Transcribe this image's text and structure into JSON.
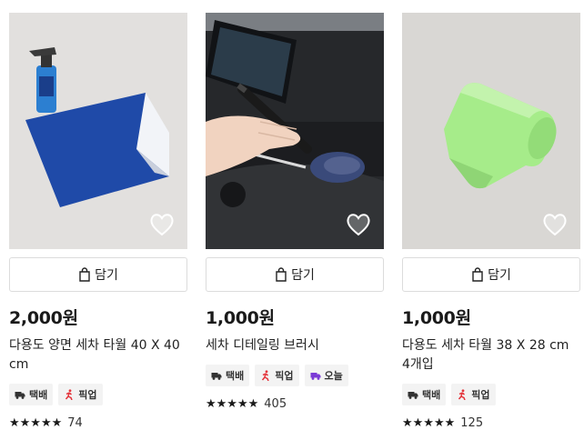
{
  "colors": {
    "towel_blue": "#1f4aa8",
    "towel_green": "#a6ec8a",
    "pickup_red": "#e4333a",
    "today_purple": "#7b3bd6",
    "star": "#1a1a1a"
  },
  "products": [
    {
      "image_icon": "blue-microfiber-towel-with-spray-bottle",
      "wishlist_icon": "heart-outline-icon",
      "cart_label": "담기",
      "price": "2,000원",
      "title": "다용도 양면 세차 타월 40 X 40 cm",
      "badges": [
        {
          "icon": "truck-icon",
          "label": "택배",
          "color": "#333333"
        },
        {
          "icon": "pickup-runner-icon",
          "label": "픽업",
          "color": "#e4333a"
        }
      ],
      "rating": 5,
      "stars": "★★★★★",
      "review_count": "74"
    },
    {
      "image_icon": "detailing-brush-in-car-interior",
      "wishlist_icon": "heart-outline-icon",
      "cart_label": "담기",
      "price": "1,000원",
      "title": "세차 디테일링 브러시",
      "badges": [
        {
          "icon": "truck-icon",
          "label": "택배",
          "color": "#333333"
        },
        {
          "icon": "pickup-runner-icon",
          "label": "픽업",
          "color": "#e4333a"
        },
        {
          "icon": "today-delivery-icon",
          "label": "오늘",
          "color": "#7b3bd6"
        }
      ],
      "rating": 5,
      "stars": "★★★★★",
      "review_count": "405"
    },
    {
      "image_icon": "rolled-green-towels",
      "wishlist_icon": "heart-outline-icon",
      "cart_label": "담기",
      "price": "1,000원",
      "title": "다용도 세차 타월 38 X 28 cm 4개입",
      "badges": [
        {
          "icon": "truck-icon",
          "label": "택배",
          "color": "#333333"
        },
        {
          "icon": "pickup-runner-icon",
          "label": "픽업",
          "color": "#e4333a"
        }
      ],
      "rating": 5,
      "stars": "★★★★★",
      "review_count": "125"
    }
  ]
}
